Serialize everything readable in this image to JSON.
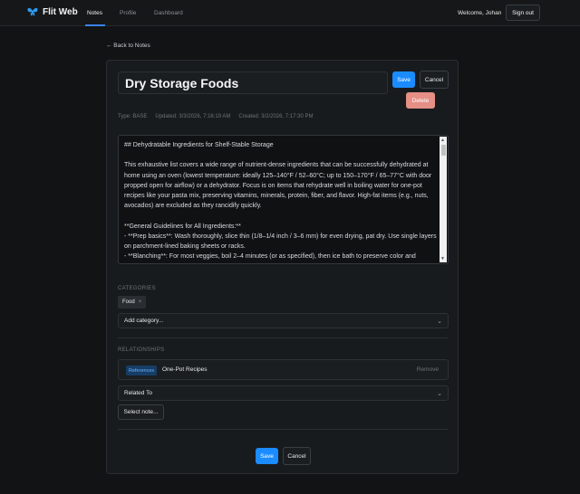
{
  "nav": {
    "brand": "Flit Web",
    "links": [
      "Notes",
      "Profile",
      "Dashboard"
    ],
    "welcome": "Welcome, Johan",
    "sign_out": "Sign out"
  },
  "back_link": "← Back to Notes",
  "note": {
    "title": "Dry Storage Foods",
    "save_label": "Save",
    "cancel_label": "Cancel",
    "delete_label": "Delete",
    "type": "Type: BASE",
    "updated": "Updated: 3/3/2026, 7:16:19 AM",
    "created": "Created: 3/2/2026, 7:17:30 PM",
    "content": "## Dehydratable Ingredients for Shelf-Stable Storage\n\nThis exhaustive list covers a wide range of nutrient-dense ingredients that can be successfully dehydrated at home using an oven (lowest temperature: ideally 125–140°F / 52–60°C; up to 150–170°F / 65–77°C with door propped open for airflow) or a dehydrator. Focus is on items that rehydrate well in boiling water for one-pot recipes like your pasta mix, preserving vitamins, minerals, protein, fiber, and flavor. High-fat items (e.g., nuts, avocados) are excluded as they rancidify quickly.\n\n**General Guidelines for All Ingredients:**\n- **Prep basics**: Wash thoroughly, slice thin (1/8–1/4 inch / 3–6 mm) for even drying, pat dry. Use single layers on parchment-lined baking sheets or racks.\n- **Blanching**: For most veggies, boil 2–4 minutes (or as specified), then ice bath to preserve color and nutrients."
  },
  "categories": {
    "label": "CATEGORIES",
    "items": [
      "Food"
    ],
    "add_placeholder": "Add category..."
  },
  "relationships": {
    "label": "RELATIONSHIPS",
    "items": [
      {
        "badge": "References",
        "title": "One-Pot Recipes",
        "remove": "Remove"
      }
    ],
    "type_select": "Related To",
    "select_note": "Select note..."
  },
  "footer": {
    "save_label": "Save",
    "cancel_label": "Cancel"
  },
  "colors": {
    "primary": "#1a8cff",
    "danger": "#e58f86",
    "background": "#111315",
    "card": "#181b1e"
  }
}
